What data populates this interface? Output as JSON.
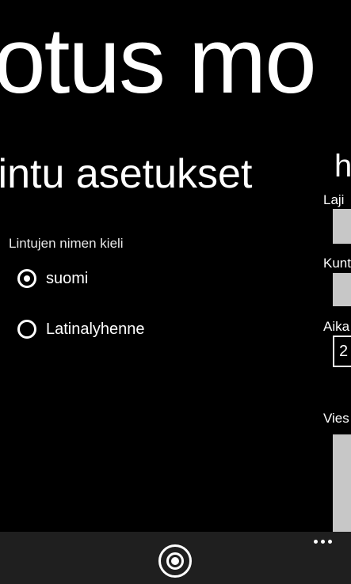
{
  "panorama": {
    "title": "otus mo"
  },
  "settings": {
    "title": "lintu asetukset",
    "language_label": "Lintujen nimen kieli",
    "options": [
      {
        "label": "suomi",
        "selected": true
      },
      {
        "label": "Latinalyhenne",
        "selected": false
      }
    ]
  },
  "next_panel": {
    "title": "h",
    "fields": [
      {
        "label": "Laji",
        "value": ""
      },
      {
        "label": "Kunt",
        "value": ""
      },
      {
        "label": "Aika",
        "value": "2"
      },
      {
        "label": "Vies",
        "value": ""
      }
    ]
  },
  "appbar": {
    "main_icon": "record-icon",
    "more_icon": "more-dots-icon"
  },
  "colors": {
    "background": "#000000",
    "text": "#ffffff",
    "field": "#c7c7c7",
    "appbar": "#1f1f1f"
  }
}
